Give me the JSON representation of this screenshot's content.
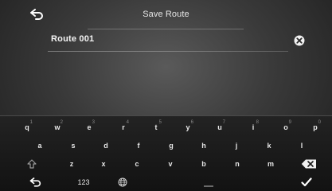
{
  "header": {
    "title": "Save Route"
  },
  "route": {
    "name_value": "Route 001"
  },
  "keyboard": {
    "row1": [
      {
        "label": "q",
        "alt": "1"
      },
      {
        "label": "w",
        "alt": "2"
      },
      {
        "label": "e",
        "alt": "3"
      },
      {
        "label": "r",
        "alt": "4"
      },
      {
        "label": "t",
        "alt": "5"
      },
      {
        "label": "y",
        "alt": "6"
      },
      {
        "label": "u",
        "alt": "7"
      },
      {
        "label": "i",
        "alt": "8"
      },
      {
        "label": "o",
        "alt": "9"
      },
      {
        "label": "p",
        "alt": "0"
      }
    ],
    "row2": [
      "a",
      "s",
      "d",
      "f",
      "g",
      "h",
      "j",
      "k",
      "l"
    ],
    "row3": [
      "z",
      "x",
      "c",
      "v",
      "b",
      "n",
      "m"
    ],
    "numbers_label": "123",
    "icons": {
      "back": "back-arrow-icon",
      "clear": "clear-icon",
      "shift": "shift-icon",
      "backspace": "backspace-icon",
      "globe": "globe-icon",
      "enter": "checkmark-icon",
      "space": "space-bar"
    }
  }
}
